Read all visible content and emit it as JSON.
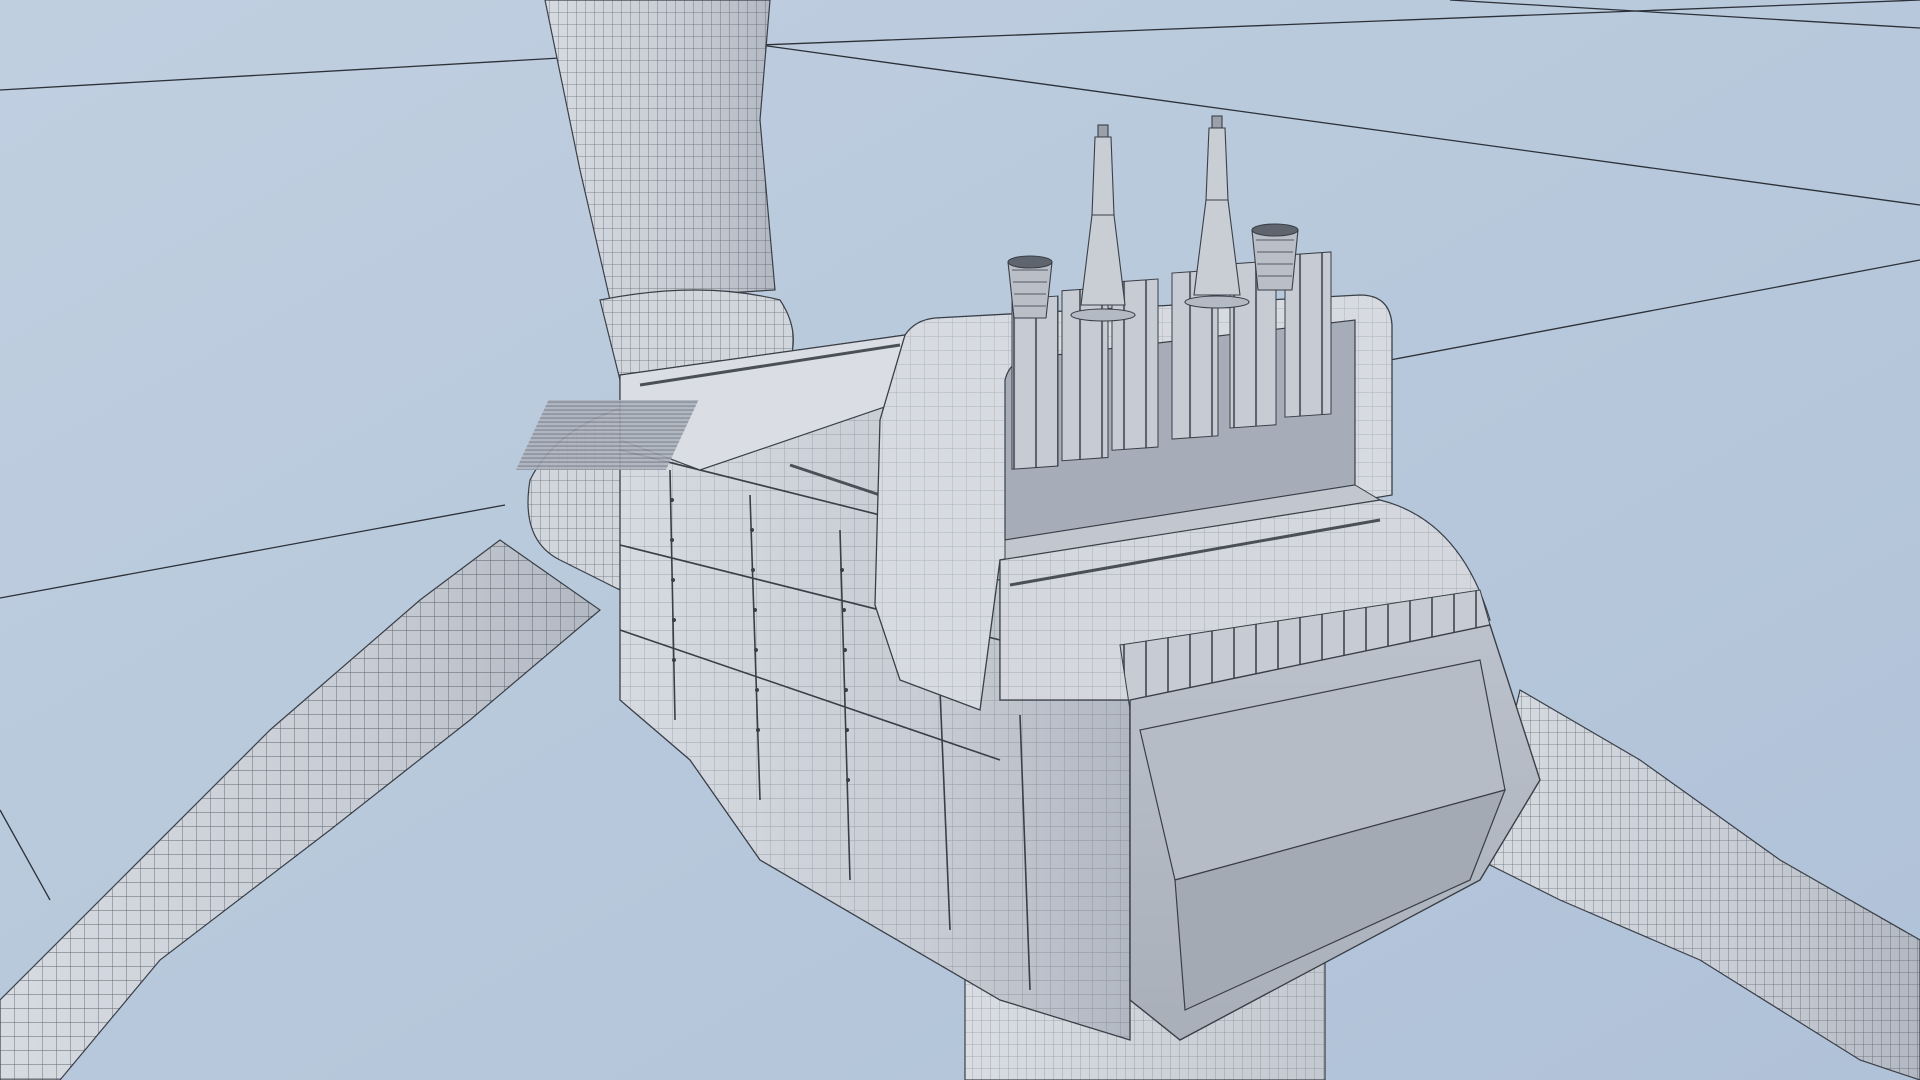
{
  "scene": {
    "subject": "wind-turbine-nacelle-wireframe-render",
    "colors": {
      "background": "#b5c6db",
      "background_light": "#c3d2e3",
      "surface": "#cdd2da",
      "surface_light": "#e3e6ec",
      "surface_dark": "#a7adb8",
      "wire": "#3a3f47",
      "ground_line": "#2c3038"
    }
  }
}
